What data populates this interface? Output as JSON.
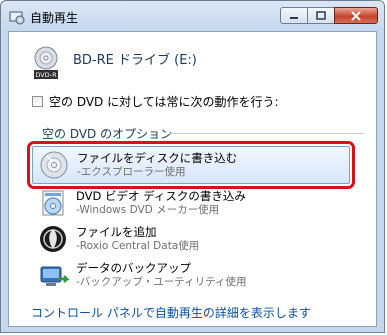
{
  "window": {
    "title": "自動再生"
  },
  "drive": {
    "label": "BD-RE ドライブ (E:)",
    "icon_name": "bd-re-disc-icon",
    "disc_badge": "DVD-R"
  },
  "checkbox": {
    "label": "空の DVD に対しては常に次の動作を行う:",
    "checked": false
  },
  "section": {
    "header": "空の DVD のオプション"
  },
  "options": [
    {
      "title": "ファイルをディスクに書き込む",
      "subtitle": "-エクスプローラー使用",
      "icon": "burn-disc-icon",
      "selected": true
    },
    {
      "title": "DVD ビデオ ディスクの書き込み",
      "subtitle": "-Windows DVD メーカー使用",
      "icon": "dvd-maker-icon",
      "selected": false
    },
    {
      "title": "ファイルを追加",
      "subtitle": "-Roxio Central Data使用",
      "icon": "roxio-icon",
      "selected": false
    },
    {
      "title": "データのバックアップ",
      "subtitle": "-バックアップ・ユーティリティ使用",
      "icon": "backup-icon",
      "selected": false
    }
  ],
  "footer": {
    "link_text": "コントロール パネルで自動再生の詳細を表示します"
  },
  "colors": {
    "highlight_box": "#d6121a",
    "link": "#0a4fa6",
    "heading": "#1e395b"
  }
}
